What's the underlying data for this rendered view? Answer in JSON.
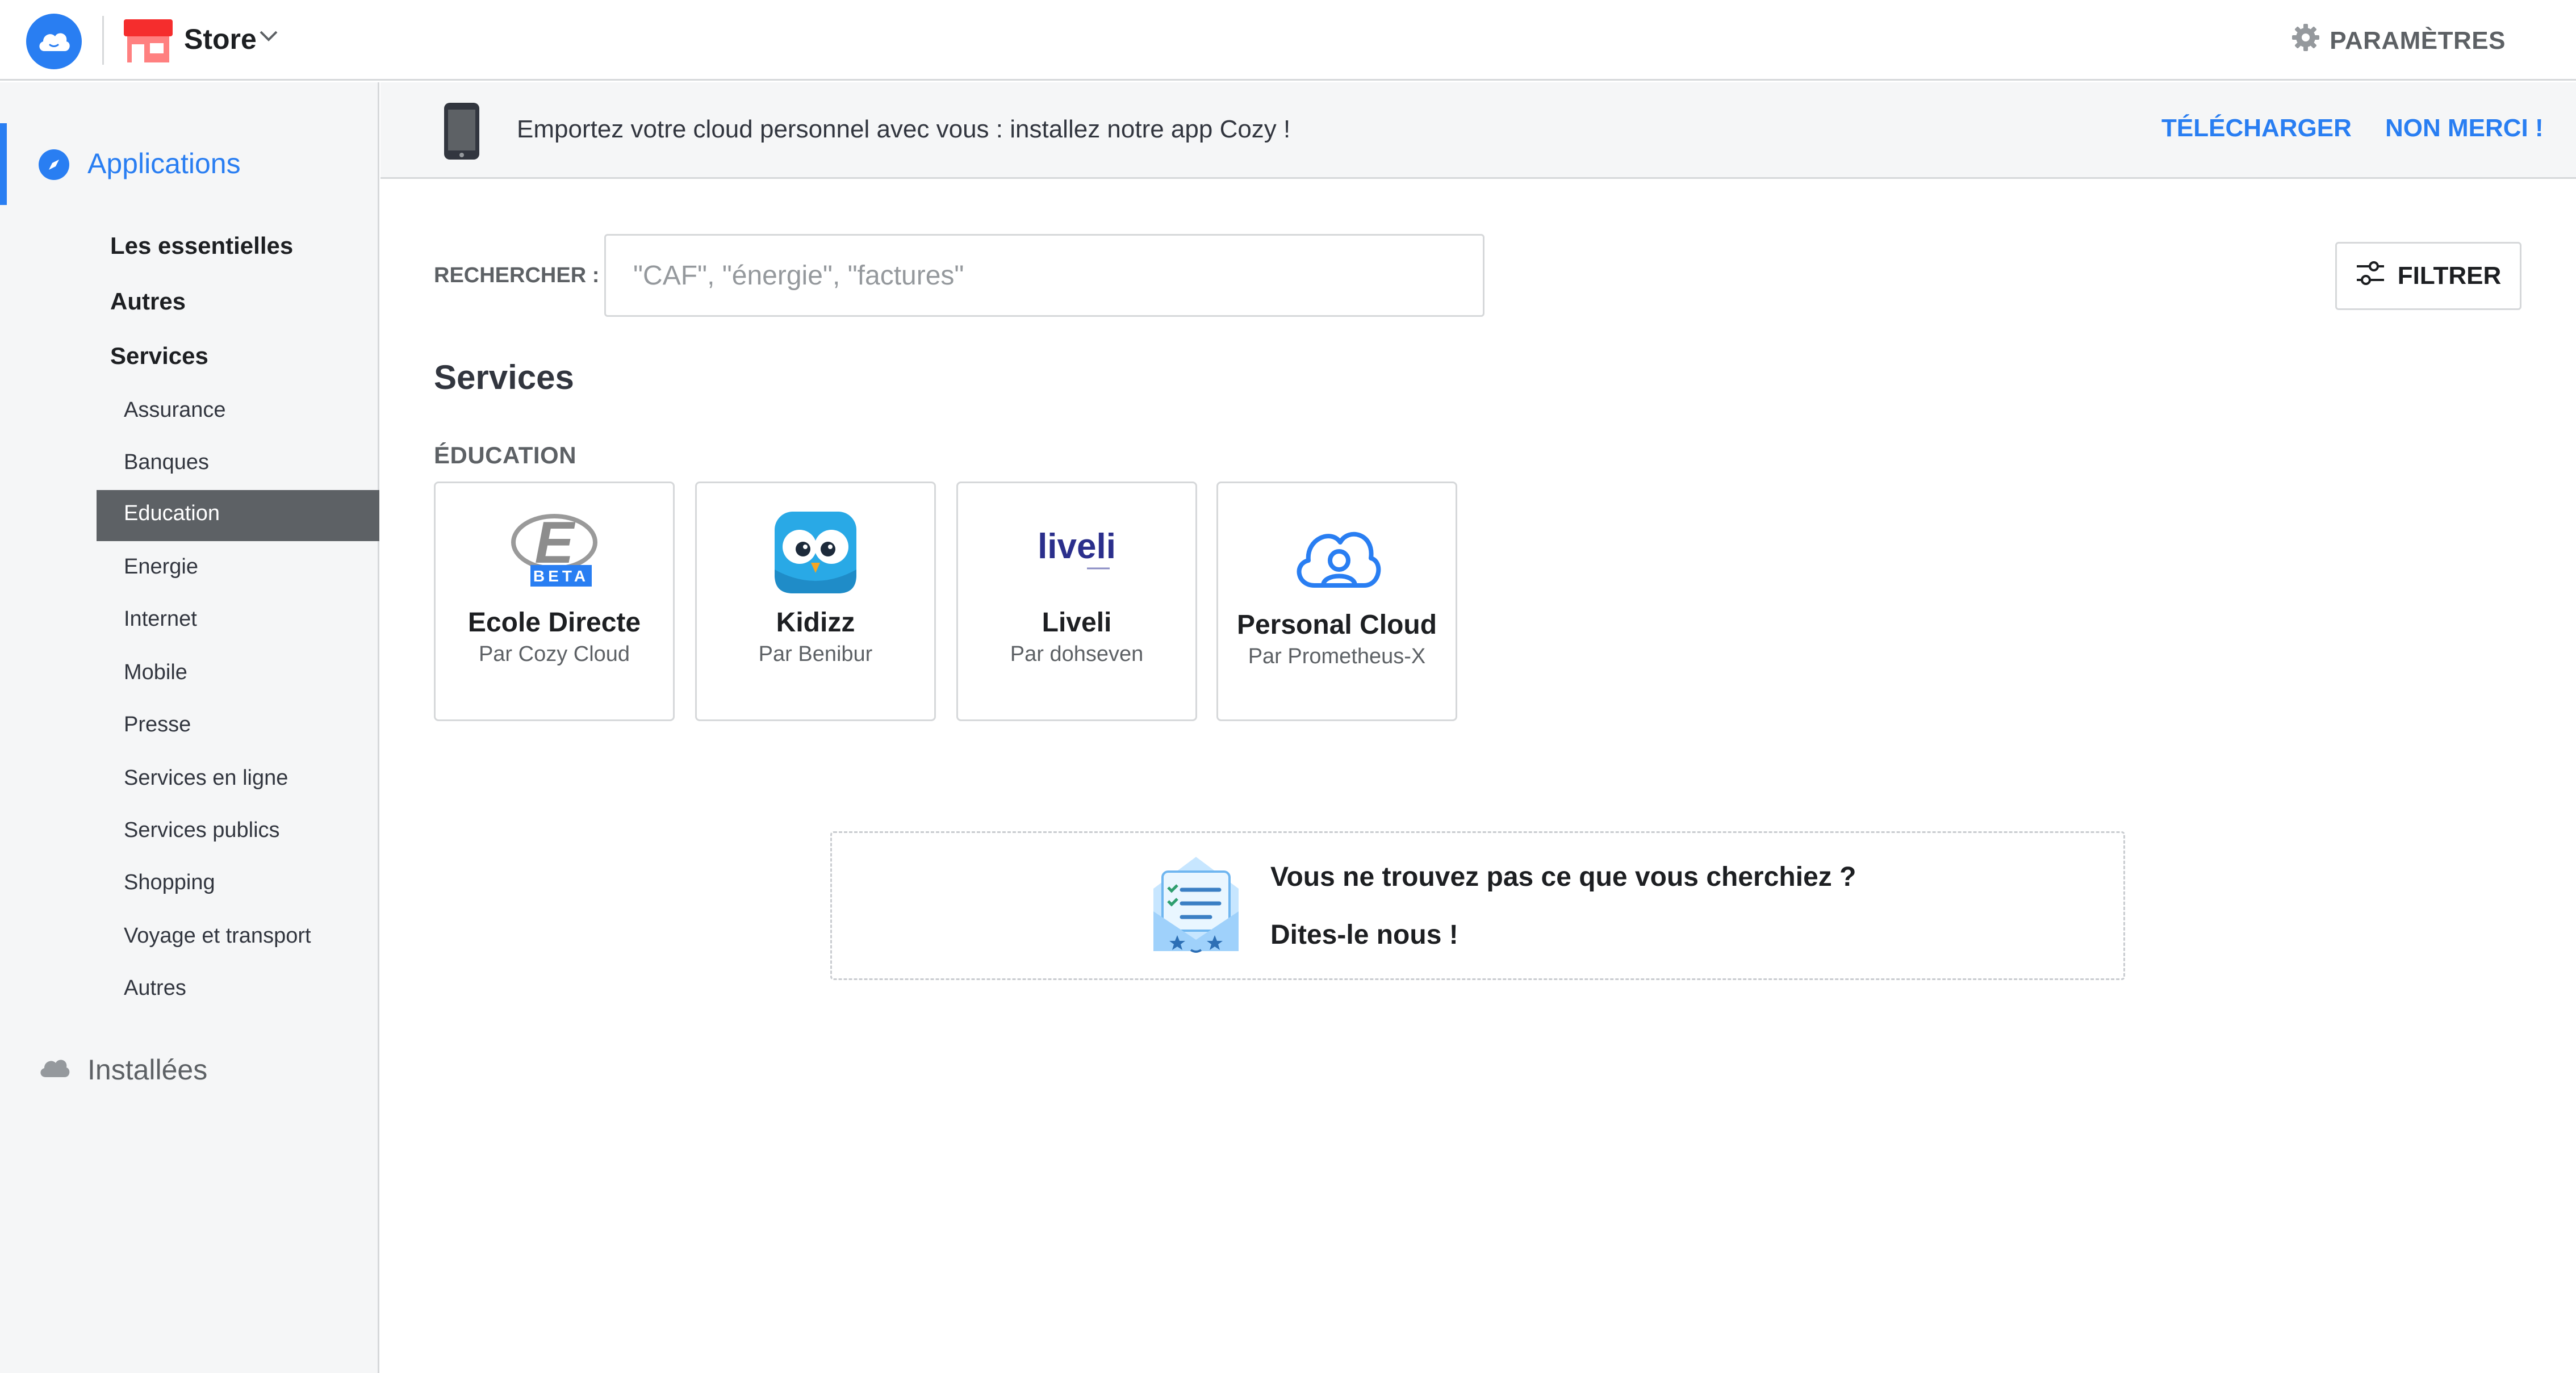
{
  "header": {
    "app_name": "Store",
    "settings_label": "PARAMÈTRES"
  },
  "sidebar": {
    "applications_label": "Applications",
    "categories": [
      {
        "label": "Les essentielles"
      },
      {
        "label": "Autres"
      },
      {
        "label": "Services"
      }
    ],
    "subcategories": [
      {
        "label": "Assurance"
      },
      {
        "label": "Banques"
      },
      {
        "label": "Education",
        "active": true
      },
      {
        "label": "Energie"
      },
      {
        "label": "Internet"
      },
      {
        "label": "Mobile"
      },
      {
        "label": "Presse"
      },
      {
        "label": "Services en ligne"
      },
      {
        "label": "Services publics"
      },
      {
        "label": "Shopping"
      },
      {
        "label": "Voyage et transport"
      },
      {
        "label": "Autres"
      }
    ],
    "installed_label": "Installées"
  },
  "banner": {
    "text": "Emportez votre cloud personnel avec vous : installez notre app Cozy !",
    "download_label": "TÉLÉCHARGER",
    "dismiss_label": "NON MERCI !"
  },
  "search": {
    "label": "RECHERCHER :",
    "placeholder": "\"CAF\", \"énergie\", \"factures\""
  },
  "filter_label": "FILTRER",
  "section_title": "Services",
  "subsection_title": "ÉDUCATION",
  "cards": [
    {
      "title": "Ecole Directe",
      "by": "Par Cozy Cloud",
      "badge": "BETA",
      "icon": "ecole-directe-logo"
    },
    {
      "title": "Kidizz",
      "by": "Par Benibur",
      "icon": "kidizz-owl-logo"
    },
    {
      "title": "Liveli",
      "by": "Par dohseven",
      "logo_text": "liveli",
      "icon": "liveli-logo"
    },
    {
      "title": "Personal Cloud",
      "by": "Par Prometheus-X",
      "icon": "personal-cloud-logo"
    }
  ],
  "suggest": {
    "question": "Vous ne trouvez pas ce que vous cherchiez ?",
    "action": "Dites-le nous !"
  },
  "colors": {
    "accent": "#297ef2",
    "store_red": "#f52d2d",
    "sidebar_bg": "#f5f6f7",
    "active_item_bg": "#5d6165"
  }
}
